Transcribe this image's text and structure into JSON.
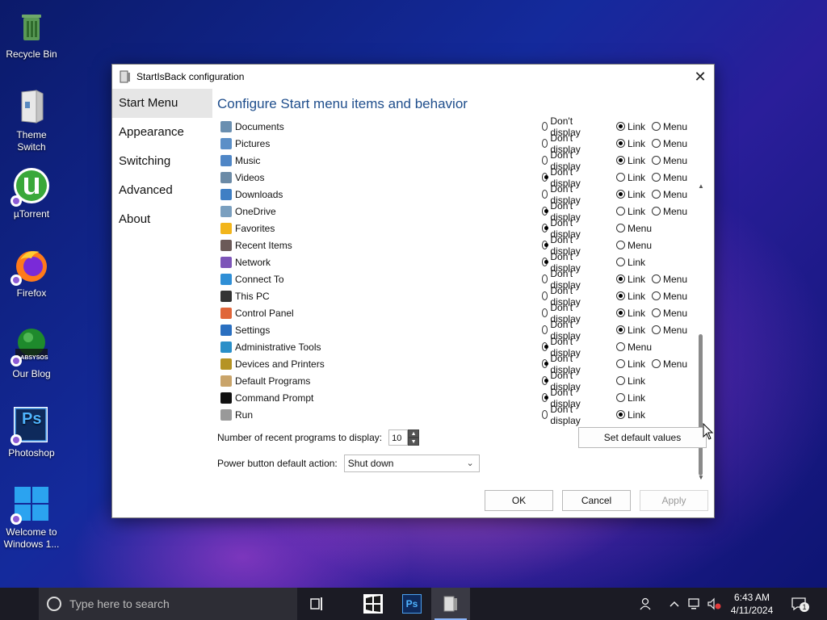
{
  "desktop": {
    "icons": [
      {
        "label": "Recycle Bin"
      },
      {
        "label": "Theme Switch"
      },
      {
        "label": "µTorrent"
      },
      {
        "label": "Firefox"
      },
      {
        "label": "Our Blog",
        "badge": "LABSYSOS"
      },
      {
        "label": "Photoshop",
        "glyph": "Ps"
      },
      {
        "label": "Welcome to Windows 1..."
      }
    ]
  },
  "dialog": {
    "title": "StartIsBack configuration",
    "close_glyph": "✕",
    "nav": [
      "Start Menu",
      "Appearance",
      "Switching",
      "Advanced",
      "About"
    ],
    "heading": "Configure Start menu items and behavior",
    "option_labels": {
      "dont": "Don't display",
      "link": "Link",
      "menu": "Menu"
    },
    "items": [
      {
        "name": "Documents",
        "icon": "documents-icon",
        "color": "#6a8fb0",
        "options": [
          "dont",
          "link",
          "menu"
        ],
        "selected": "link"
      },
      {
        "name": "Pictures",
        "icon": "pictures-icon",
        "color": "#5b8fc7",
        "options": [
          "dont",
          "link",
          "menu"
        ],
        "selected": "link"
      },
      {
        "name": "Music",
        "icon": "music-icon",
        "color": "#4f86c6",
        "options": [
          "dont",
          "link",
          "menu"
        ],
        "selected": "link"
      },
      {
        "name": "Videos",
        "icon": "videos-icon",
        "color": "#6b8aa6",
        "options": [
          "dont",
          "link",
          "menu"
        ],
        "selected": "dont"
      },
      {
        "name": "Downloads",
        "icon": "downloads-icon",
        "color": "#3f7fc4",
        "options": [
          "dont",
          "link",
          "menu"
        ],
        "selected": "link"
      },
      {
        "name": "OneDrive",
        "icon": "onedrive-icon",
        "color": "#7a9fbf",
        "options": [
          "dont",
          "link",
          "menu"
        ],
        "selected": "dont"
      },
      {
        "name": "Favorites",
        "icon": "favorites-icon",
        "color": "#f2b51b",
        "options": [
          "dont",
          "menu"
        ],
        "selected": "dont"
      },
      {
        "name": "Recent Items",
        "icon": "recent-items-icon",
        "color": "#6b5a58",
        "options": [
          "dont",
          "menu"
        ],
        "selected": "dont"
      },
      {
        "name": "Network",
        "icon": "network-icon",
        "color": "#7d55b8",
        "options": [
          "dont",
          "link"
        ],
        "selected": "dont"
      },
      {
        "name": "Connect To",
        "icon": "connect-to-icon",
        "color": "#2f8fd6",
        "options": [
          "dont",
          "link",
          "menu"
        ],
        "selected": "link"
      },
      {
        "name": "This PC",
        "icon": "this-pc-icon",
        "color": "#333333",
        "options": [
          "dont",
          "link",
          "menu"
        ],
        "selected": "link"
      },
      {
        "name": "Control Panel",
        "icon": "control-panel-icon",
        "color": "#e0663a",
        "options": [
          "dont",
          "link",
          "menu"
        ],
        "selected": "link"
      },
      {
        "name": "Settings",
        "icon": "settings-icon",
        "color": "#2a6fc0",
        "options": [
          "dont",
          "link",
          "menu"
        ],
        "selected": "link"
      },
      {
        "name": "Administrative Tools",
        "icon": "administrative-tools-icon",
        "color": "#2a8fc8",
        "options": [
          "dont",
          "menu"
        ],
        "selected": "dont"
      },
      {
        "name": "Devices and Printers",
        "icon": "devices-printers-icon",
        "color": "#b59324",
        "options": [
          "dont",
          "link",
          "menu"
        ],
        "selected": "dont"
      },
      {
        "name": "Default Programs",
        "icon": "default-programs-icon",
        "color": "#c9a46a",
        "options": [
          "dont",
          "link"
        ],
        "selected": "dont"
      },
      {
        "name": "Command Prompt",
        "icon": "command-prompt-icon",
        "color": "#111111",
        "options": [
          "dont",
          "link"
        ],
        "selected": "dont"
      },
      {
        "name": "Run",
        "icon": "run-icon",
        "color": "#999999",
        "options": [
          "dont",
          "link"
        ],
        "selected": "link"
      }
    ],
    "recent_label": "Number of recent programs to display:",
    "recent_value": "10",
    "power_label": "Power button default action:",
    "power_value": "Shut down",
    "defaults_button": "Set default values",
    "ok_button": "OK",
    "cancel_button": "Cancel",
    "apply_button": "Apply",
    "scroll_fraction": 0.5
  },
  "taskbar": {
    "search_placeholder": "Type here to search",
    "time": "6:43 AM",
    "date": "4/11/2024",
    "notification_count": "1",
    "photoshop_glyph": "Ps"
  }
}
